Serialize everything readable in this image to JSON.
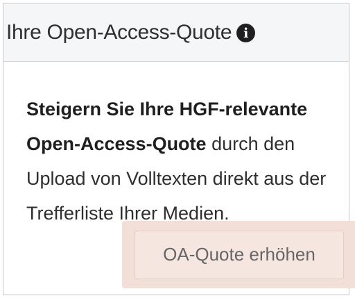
{
  "panel": {
    "title": "Ihre Open-Access-Quote",
    "info_icon": "i",
    "body_bold": "Steigern Sie Ihre HGF-relevante Open-Access-Quote",
    "body_rest": " durch den Upload von Volltexten direkt aus der Trefferliste Ihrer Medien.",
    "button_label": "OA-Quote erhöhen"
  },
  "colors": {
    "header_bg": "#f5f6f8",
    "button_bg": "#f2dfd8",
    "button_text": "#666666"
  },
  "icons": {
    "info": "info-circle-icon"
  }
}
